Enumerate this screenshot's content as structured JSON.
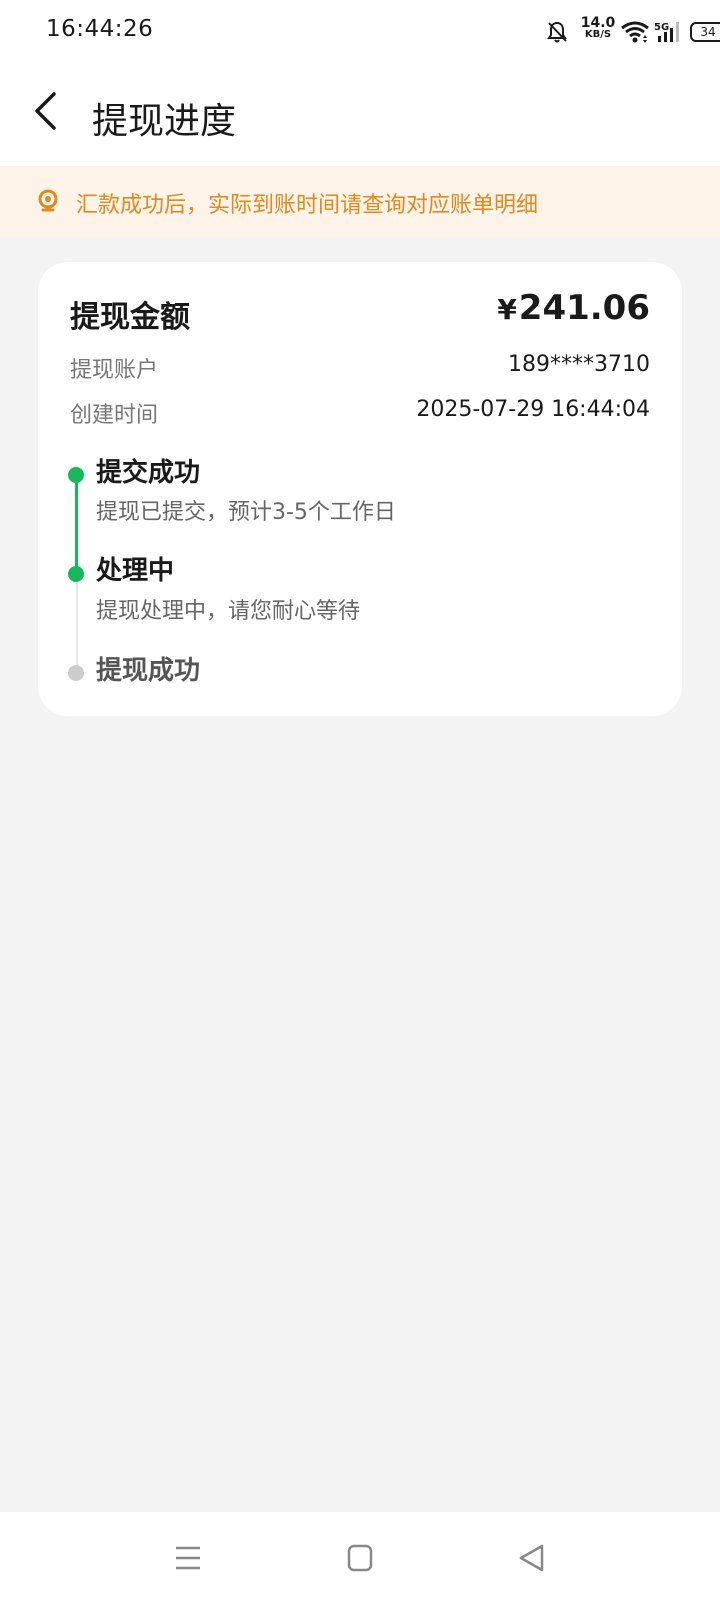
{
  "status_bar": {
    "time": "16:44:26",
    "net_speed": "14.0",
    "net_unit": "KB/S",
    "cell_label": "5G",
    "battery": "34",
    "icons": [
      "bell-off-icon",
      "wifi-icon",
      "cellular-signal-icon",
      "battery-icon"
    ]
  },
  "header": {
    "title": "提现进度",
    "back_icon": "chevron-left-icon"
  },
  "notice": {
    "icon": "lightbulb-icon",
    "text": "汇款成功后，实际到账时间请查询对应账单明细",
    "color": "#e08a1e",
    "background": "#fdf3e8"
  },
  "card": {
    "amount_label": "提现金额",
    "amount_currency": "¥",
    "amount_value": "241.06",
    "rows": [
      {
        "label": "提现账户",
        "value": "189****3710"
      },
      {
        "label": "创建时间",
        "value": "2025-07-29 16:44:04"
      }
    ],
    "timeline": [
      {
        "title": "提交成功",
        "desc": "提现已提交，预计3-5个工作日",
        "status": "done"
      },
      {
        "title": "处理中",
        "desc": "提现处理中，请您耐心等待",
        "status": "done"
      },
      {
        "title": "提现成功",
        "desc": "",
        "status": "pending"
      }
    ],
    "accent_color": "#16b85a"
  },
  "navbar": {
    "icons": [
      "menu-icon",
      "home-square-icon",
      "back-triangle-icon"
    ]
  }
}
